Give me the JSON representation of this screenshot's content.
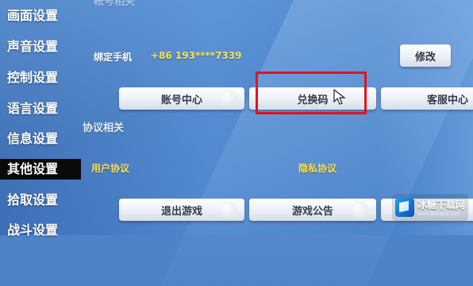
{
  "sidebar": {
    "items": [
      {
        "label": "画面设置",
        "active": false
      },
      {
        "label": "声音设置",
        "active": false
      },
      {
        "label": "控制设置",
        "active": false
      },
      {
        "label": "语言设置",
        "active": false
      },
      {
        "label": "信息设置",
        "active": false
      },
      {
        "label": "其他设置",
        "active": true
      },
      {
        "label": "拾取设置",
        "active": false
      },
      {
        "label": "战斗设置",
        "active": false
      }
    ]
  },
  "account_section": {
    "title": "帐号相关",
    "bind_phone_label": "绑定手机",
    "bind_phone_value": "+86 193****7339",
    "modify_button": "修改",
    "buttons": [
      "账号中心",
      "兑换码",
      "客服中心"
    ]
  },
  "agreement_section": {
    "title": "协议相关",
    "user_agreement": "用户协议",
    "privacy_agreement": "隐私协议",
    "buttons": [
      "退出游戏",
      "游戏公告"
    ]
  },
  "watermark": {
    "title": "冰糖下载网",
    "url": "www.btxiazai.com"
  },
  "colors": {
    "highlight": "#e0141c",
    "phone_value": "#f3e35a",
    "link": "#ffe04a"
  }
}
